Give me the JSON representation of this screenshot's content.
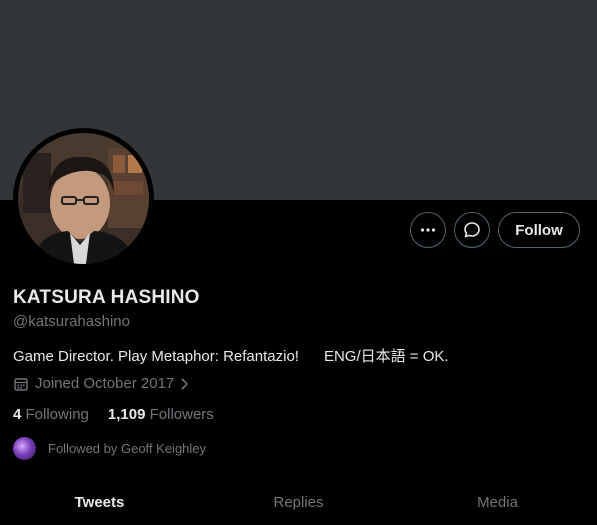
{
  "profile": {
    "name": "KATSURA HASHINO",
    "handle": "@katsurahashino",
    "bio": "Game Director. Play Metaphor: Refantazio!      ENG/日本語 = OK.",
    "joined": "Joined October 2017",
    "following_count": "4",
    "following_label": "Following",
    "followers_count": "1,109",
    "followers_label": "Followers",
    "followed_by": "Followed by Geoff Keighley"
  },
  "actions": {
    "more_icon": "more-icon",
    "message_icon": "message-icon",
    "follow_label": "Follow"
  },
  "tabs": [
    {
      "label": "Tweets",
      "active": true
    },
    {
      "label": "Replies",
      "active": false
    },
    {
      "label": "Media",
      "active": false
    }
  ],
  "colors": {
    "background": "#000000",
    "banner": "#333639",
    "muted_text": "#71767b",
    "primary_text": "#e7e9ea",
    "button_border": "#536471"
  }
}
